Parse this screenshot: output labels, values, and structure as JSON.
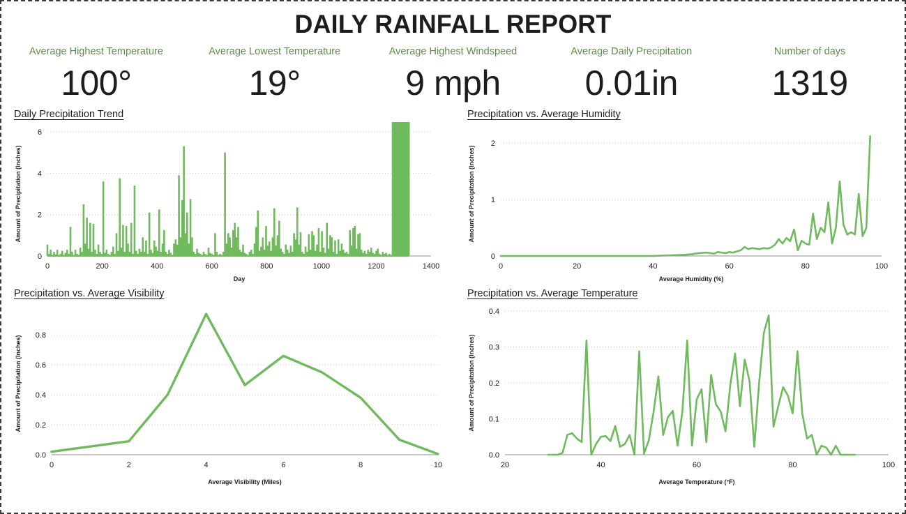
{
  "header": {
    "title": "DAILY RAINFALL REPORT"
  },
  "colors": {
    "accent_green": "#6fba5c",
    "label_green": "#5f8a4e",
    "text_dark": "#1d1d1b",
    "gridline": "#c9c9c9",
    "axis": "#8c8c8c",
    "border": "#3a3a3a",
    "background": "#ffffff"
  },
  "kpis": [
    {
      "label": "Average Highest Temperature",
      "value": "100°"
    },
    {
      "label": "Average Lowest Temperature",
      "value": "19°"
    },
    {
      "label": "Average Highest Windspeed",
      "value": "9 mph"
    },
    {
      "label": "Average Daily Precipitation",
      "value": "0.01in"
    },
    {
      "label": "Number of days",
      "value": "1319"
    }
  ],
  "chart_data": [
    {
      "id": "daily-precipitation-trend",
      "type": "area",
      "title": "Daily Precipitation Trend",
      "xlabel": "Day",
      "ylabel": "Amount of Precipitation (Inches)",
      "xlim": [
        0,
        1400
      ],
      "ylim": [
        0,
        6
      ],
      "xticks": [
        0,
        200,
        400,
        600,
        800,
        1000,
        1200,
        1400
      ],
      "yticks": [
        0,
        2,
        4,
        6
      ],
      "grid": true,
      "legend": "none",
      "x": [
        0,
        6,
        12,
        18,
        24,
        30,
        36,
        42,
        48,
        54,
        60,
        66,
        72,
        78,
        84,
        90,
        96,
        102,
        108,
        114,
        120,
        126,
        132,
        138,
        144,
        150,
        156,
        162,
        168,
        174,
        180,
        186,
        192,
        198,
        204,
        210,
        216,
        222,
        228,
        234,
        240,
        246,
        252,
        258,
        264,
        270,
        276,
        282,
        288,
        294,
        300,
        306,
        312,
        318,
        324,
        330,
        336,
        342,
        348,
        354,
        360,
        366,
        372,
        378,
        384,
        390,
        396,
        402,
        408,
        414,
        420,
        426,
        432,
        438,
        444,
        450,
        456,
        462,
        468,
        474,
        480,
        486,
        492,
        498,
        504,
        510,
        516,
        522,
        528,
        534,
        540,
        546,
        552,
        558,
        564,
        570,
        576,
        582,
        588,
        594,
        600,
        606,
        612,
        618,
        624,
        630,
        636,
        642,
        648,
        654,
        660,
        666,
        672,
        678,
        684,
        690,
        696,
        702,
        708,
        714,
        720,
        726,
        732,
        738,
        744,
        750,
        756,
        762,
        768,
        774,
        780,
        786,
        792,
        798,
        804,
        810,
        816,
        822,
        828,
        834,
        840,
        846,
        852,
        858,
        864,
        870,
        876,
        882,
        888,
        894,
        900,
        906,
        912,
        918,
        924,
        930,
        936,
        942,
        948,
        954,
        960,
        966,
        972,
        978,
        984,
        990,
        996,
        1002,
        1008,
        1014,
        1020,
        1026,
        1032,
        1038,
        1044,
        1050,
        1056,
        1062,
        1068,
        1074,
        1080,
        1086,
        1092,
        1098,
        1104,
        1110,
        1116,
        1122,
        1128,
        1134,
        1140,
        1146,
        1152,
        1158,
        1164,
        1170,
        1176,
        1182,
        1188,
        1194,
        1200,
        1206,
        1212,
        1218,
        1224,
        1230,
        1236,
        1242,
        1248,
        1254,
        1260,
        1266,
        1272,
        1278,
        1284,
        1290,
        1296,
        1302,
        1308,
        1314,
        1319
      ],
      "values": [
        0.55,
        0.1,
        0.3,
        0.05,
        0.2,
        0.08,
        0.3,
        0.05,
        0.1,
        0.25,
        0.05,
        0.15,
        0.3,
        0.1,
        1.4,
        0.2,
        0.05,
        0.3,
        0.1,
        0.05,
        0.4,
        0.2,
        2.5,
        0.6,
        1.85,
        0.35,
        1.6,
        0.2,
        1.55,
        0.3,
        0.1,
        0.55,
        0.2,
        0.1,
        3.6,
        0.15,
        0.3,
        0.1,
        0.05,
        0.2,
        0.45,
        0.1,
        1.1,
        0.25,
        3.75,
        0.4,
        1.5,
        0.2,
        1.45,
        0.6,
        0.2,
        1.6,
        0.1,
        3.4,
        0.25,
        0.1,
        0.35,
        0.2,
        0.9,
        0.2,
        0.75,
        0.1,
        2.1,
        0.3,
        0.15,
        0.75,
        0.45,
        0.25,
        2.25,
        0.2,
        0.6,
        1.25,
        0.2,
        0.1,
        0.3,
        0.15,
        0.05,
        0.6,
        0.8,
        0.55,
        3.9,
        0.9,
        2.7,
        5.3,
        1.1,
        2.1,
        0.6,
        2.75,
        0.9,
        0.2,
        0.1,
        0.35,
        0.15,
        0.1,
        0.05,
        0.2,
        0.1,
        0.05,
        0.4,
        0.15,
        0.1,
        0.05,
        1.1,
        0.2,
        0.05,
        0.1,
        0.05,
        0.2,
        5.0,
        0.6,
        1.1,
        0.9,
        0.4,
        1.25,
        1.6,
        0.9,
        1.4,
        0.3,
        0.2,
        0.55,
        0.15,
        0.1,
        0.05,
        0.2,
        0.3,
        0.1,
        0.6,
        1.4,
        2.2,
        0.25,
        0.45,
        0.9,
        0.3,
        1.45,
        0.5,
        0.7,
        0.25,
        0.9,
        2.3,
        0.5,
        1.0,
        1.7,
        0.35,
        0.2,
        0.1,
        0.55,
        0.3,
        0.15,
        0.5,
        0.2,
        1.1,
        0.8,
        2.35,
        0.55,
        1.15,
        0.2,
        0.1,
        0.45,
        0.2,
        1.05,
        0.3,
        1.2,
        1.0,
        0.25,
        0.55,
        1.35,
        0.2,
        1.2,
        0.4,
        0.15,
        1.6,
        0.35,
        1.0,
        0.9,
        0.2,
        0.75,
        0.1,
        0.8,
        0.25,
        0.6,
        0.3,
        0.15,
        0.2,
        0.1,
        1.25,
        0.5,
        1.35,
        1.45,
        0.35,
        1.05,
        1.1,
        0.3,
        0.15,
        0.25,
        0.1,
        0.3,
        0.2,
        0.4,
        0.15,
        0.1,
        0.25,
        0.35,
        0.1,
        0.05,
        0.2,
        0.1,
        0.15,
        0.05,
        0.1,
        0.05
      ]
    },
    {
      "id": "precipitation-vs-average-humidity",
      "type": "line",
      "title": "Precipitation vs. Average Humidity",
      "xlabel": "Average Humidity (%)",
      "ylabel": "Amount of Precipitation (Inches)",
      "xlim": [
        0,
        100
      ],
      "ylim": [
        0,
        2.2
      ],
      "xticks": [
        0,
        20,
        40,
        60,
        80,
        100
      ],
      "yticks": [
        0,
        1,
        2
      ],
      "grid": true,
      "legend": "none",
      "x": [
        0,
        20,
        30,
        36,
        40,
        44,
        48,
        50,
        52,
        54,
        56,
        57,
        58,
        59,
        60,
        61,
        62,
        63,
        64,
        65,
        66,
        67,
        68,
        69,
        70,
        71,
        72,
        73,
        74,
        75,
        76,
        77,
        78,
        79,
        80,
        81,
        82,
        83,
        84,
        85,
        86,
        87,
        88,
        89,
        90,
        91,
        92,
        93,
        94,
        95,
        96,
        97
      ],
      "values": [
        0.0,
        0.0,
        0.0,
        0.0,
        0.0,
        0.01,
        0.02,
        0.03,
        0.05,
        0.06,
        0.04,
        0.07,
        0.06,
        0.05,
        0.07,
        0.06,
        0.08,
        0.1,
        0.16,
        0.12,
        0.14,
        0.13,
        0.12,
        0.14,
        0.13,
        0.15,
        0.2,
        0.3,
        0.22,
        0.32,
        0.26,
        0.47,
        0.1,
        0.27,
        0.22,
        0.2,
        0.75,
        0.3,
        0.5,
        0.42,
        0.95,
        0.22,
        0.5,
        1.32,
        0.55,
        0.38,
        0.42,
        0.38,
        1.1,
        0.35,
        0.5,
        2.12
      ]
    },
    {
      "id": "precipitation-vs-average-visibility",
      "type": "line",
      "title": "Precipitation vs. Average Visibility",
      "xlabel": "Average Visibility (Miles)",
      "ylabel": "Amount of Precipitation (Inches)",
      "xlim": [
        0,
        10
      ],
      "ylim": [
        0,
        0.95
      ],
      "xticks": [
        0,
        2,
        4,
        6,
        8,
        10
      ],
      "yticks": [
        0.0,
        0.2,
        0.4,
        0.6,
        0.8
      ],
      "ytick_labels": [
        "0.0",
        "0.2",
        "0.4",
        "0.6",
        "0.8"
      ],
      "grid": true,
      "legend": "none",
      "x": [
        0,
        1,
        2,
        3,
        4,
        5,
        6,
        7,
        8,
        9,
        10
      ],
      "values": [
        0.02,
        0.055,
        0.09,
        0.4,
        0.94,
        0.465,
        0.66,
        0.55,
        0.38,
        0.1,
        0.005
      ]
    },
    {
      "id": "precipitation-vs-average-temperature",
      "type": "line",
      "title": "Precipitation vs. Average Temperature",
      "xlabel": "Average Temperature (°F)",
      "ylabel": "Amount of Precipitation (Inches)",
      "xlim": [
        20,
        100
      ],
      "ylim": [
        0,
        0.4
      ],
      "xticks": [
        20,
        40,
        60,
        80,
        100
      ],
      "yticks": [
        0.0,
        0.1,
        0.2,
        0.3,
        0.4
      ],
      "ytick_labels": [
        "0.0",
        "0.1",
        "0.2",
        "0.3",
        "0.4"
      ],
      "grid": true,
      "legend": "none",
      "x": [
        29,
        30,
        31,
        32,
        33,
        34,
        35,
        36,
        37,
        38,
        39,
        40,
        41,
        42,
        43,
        44,
        45,
        46,
        47,
        48,
        49,
        50,
        51,
        52,
        53,
        54,
        55,
        56,
        57,
        58,
        59,
        60,
        61,
        62,
        63,
        64,
        65,
        66,
        67,
        68,
        69,
        70,
        71,
        72,
        73,
        74,
        75,
        76,
        77,
        78,
        79,
        80,
        81,
        82,
        83,
        84,
        85,
        86,
        87,
        88,
        89,
        90,
        91,
        92,
        93
      ],
      "values": [
        0.0,
        0.0,
        0.0,
        0.005,
        0.055,
        0.06,
        0.045,
        0.035,
        0.318,
        0.0,
        0.03,
        0.05,
        0.052,
        0.038,
        0.08,
        0.022,
        0.03,
        0.055,
        0.0,
        0.288,
        0.003,
        0.04,
        0.12,
        0.218,
        0.055,
        0.105,
        0.122,
        0.025,
        0.12,
        0.318,
        0.025,
        0.155,
        0.182,
        0.035,
        0.222,
        0.14,
        0.12,
        0.065,
        0.195,
        0.282,
        0.135,
        0.265,
        0.205,
        0.022,
        0.2,
        0.34,
        0.388,
        0.078,
        0.135,
        0.188,
        0.165,
        0.115,
        0.288,
        0.115,
        0.045,
        0.055,
        0.0,
        0.025,
        0.02,
        0.0,
        0.025,
        0.0,
        0.0,
        0.0,
        0.0
      ]
    }
  ]
}
